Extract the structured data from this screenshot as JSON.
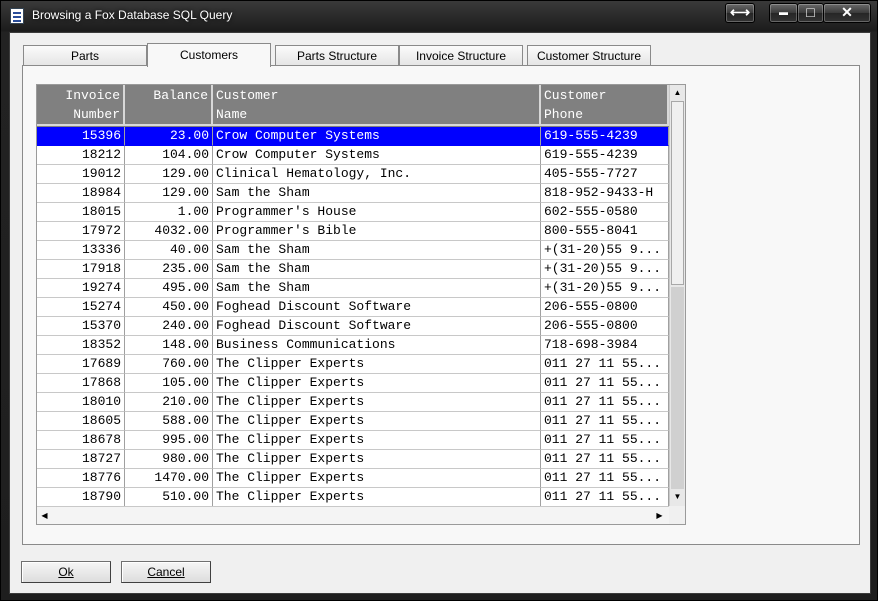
{
  "window": {
    "title": "Browsing a Fox Database SQL Query",
    "buttons": {
      "restore_icon": "resize-arrows-icon",
      "minimize_glyph": "▬",
      "maximize_glyph": "□",
      "close_glyph": "✕"
    }
  },
  "tabs": [
    {
      "label": "Parts",
      "active": false
    },
    {
      "label": "Customers",
      "active": true
    },
    {
      "label": "Parts Structure",
      "active": false
    },
    {
      "label": "Invoice Structure",
      "active": false
    },
    {
      "label": "Customer Structure",
      "active": false
    }
  ],
  "grid": {
    "columns": [
      {
        "line1": "Invoice",
        "line2": "Number",
        "align": "right"
      },
      {
        "line1": "Balance",
        "line2": "",
        "align": "right"
      },
      {
        "line1": "Customer",
        "line2": "Name",
        "align": "left"
      },
      {
        "line1": "Customer",
        "line2": "Phone",
        "align": "left"
      }
    ],
    "rows": [
      [
        "15396",
        "23.00",
        "Crow Computer Systems",
        "619-555-4239"
      ],
      [
        "18212",
        "104.00",
        "Crow Computer Systems",
        "619-555-4239"
      ],
      [
        "19012",
        "129.00",
        "Clinical Hematology, Inc.",
        "405-555-7727"
      ],
      [
        "18984",
        "129.00",
        "Sam the Sham",
        "818-952-9433-H"
      ],
      [
        "18015",
        "1.00",
        "Programmer's House",
        "602-555-0580"
      ],
      [
        "17972",
        "4032.00",
        "Programmer's Bible",
        "800-555-8041"
      ],
      [
        "13336",
        "40.00",
        "Sam the Sham",
        "+(31-20)55 9..."
      ],
      [
        "17918",
        "235.00",
        "Sam the Sham",
        "+(31-20)55 9..."
      ],
      [
        "19274",
        "495.00",
        "Sam the Sham",
        "+(31-20)55 9..."
      ],
      [
        "15274",
        "450.00",
        "Foghead Discount Software",
        "206-555-0800"
      ],
      [
        "15370",
        "240.00",
        "Foghead Discount Software",
        "206-555-0800"
      ],
      [
        "18352",
        "148.00",
        "Business Communications",
        "718-698-3984"
      ],
      [
        "17689",
        "760.00",
        "The Clipper Experts",
        "011 27 11 55..."
      ],
      [
        "17868",
        "105.00",
        "The Clipper Experts",
        "011 27 11 55..."
      ],
      [
        "18010",
        "210.00",
        "The Clipper Experts",
        "011 27 11 55..."
      ],
      [
        "18605",
        "588.00",
        "The Clipper Experts",
        "011 27 11 55..."
      ],
      [
        "18678",
        "995.00",
        "The Clipper Experts",
        "011 27 11 55..."
      ],
      [
        "18727",
        "980.00",
        "The Clipper Experts",
        "011 27 11 55..."
      ],
      [
        "18776",
        "1470.00",
        "The Clipper Experts",
        "011 27 11 55..."
      ],
      [
        "18790",
        "510.00",
        "The Clipper Experts",
        "011 27 11 55..."
      ]
    ],
    "selected_row": 0,
    "selection_color": "#0000ff"
  },
  "buttons": {
    "ok_label": "Ok",
    "cancel_label": "Cancel"
  }
}
